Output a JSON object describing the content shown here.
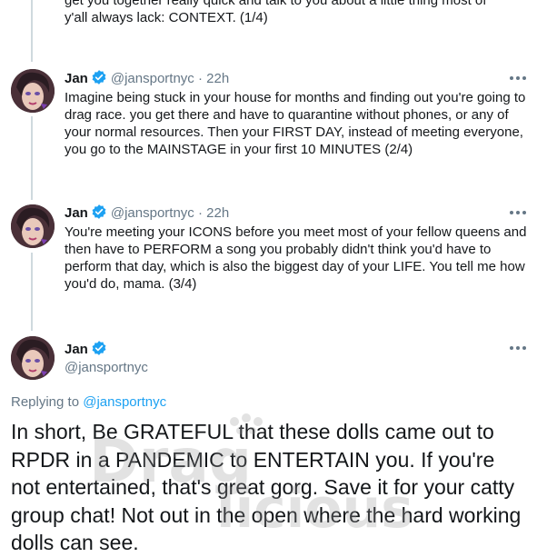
{
  "thread": {
    "top_tweet": {
      "text_partial_line1": "get you together really quick and talk to you about a little thing most of",
      "text_line2": "y'all always lack: CONTEXT. (1/4)"
    },
    "tweets": [
      {
        "name": "Jan",
        "handle": "@jansportnyc",
        "dot": "·",
        "time": "22h",
        "text": "Imagine being stuck in your house for months and finding out you're going to drag race. you get there and have to quarantine without phones, or any of your normal resources. Then your FIRST DAY, instead of meeting everyone, you go to the MAINSTAGE in your first 10 MINUTES (2/4)"
      },
      {
        "name": "Jan",
        "handle": "@jansportnyc",
        "dot": "·",
        "time": "22h",
        "text": "You're meeting your ICONS before you meet most of your fellow queens and then have to PERFORM a song you probably didn't think you'd have to perform that day, which is also the biggest day of your LIFE. You tell me how you'd do, mama. (3/4)"
      }
    ],
    "main_tweet": {
      "name": "Jan",
      "handle": "@jansportnyc",
      "replying_prefix": "Replying to",
      "replying_to": "@jansportnyc",
      "text": "In short, Be GRATEFUL that these dolls came out to RPDR in a PANDEMIC to ENTERTAIN you. If you're not entertained, that's great gorg. Save it for your catty group chat! Not out in the open where the hard working dolls can see."
    }
  },
  "watermark": {
    "text_line1": "Drag",
    "text_line2": "licious"
  },
  "colors": {
    "verified": "#1da1f2",
    "secondary_text": "#657786",
    "link": "#1da1f2",
    "thread_line": "#cfd9de"
  }
}
